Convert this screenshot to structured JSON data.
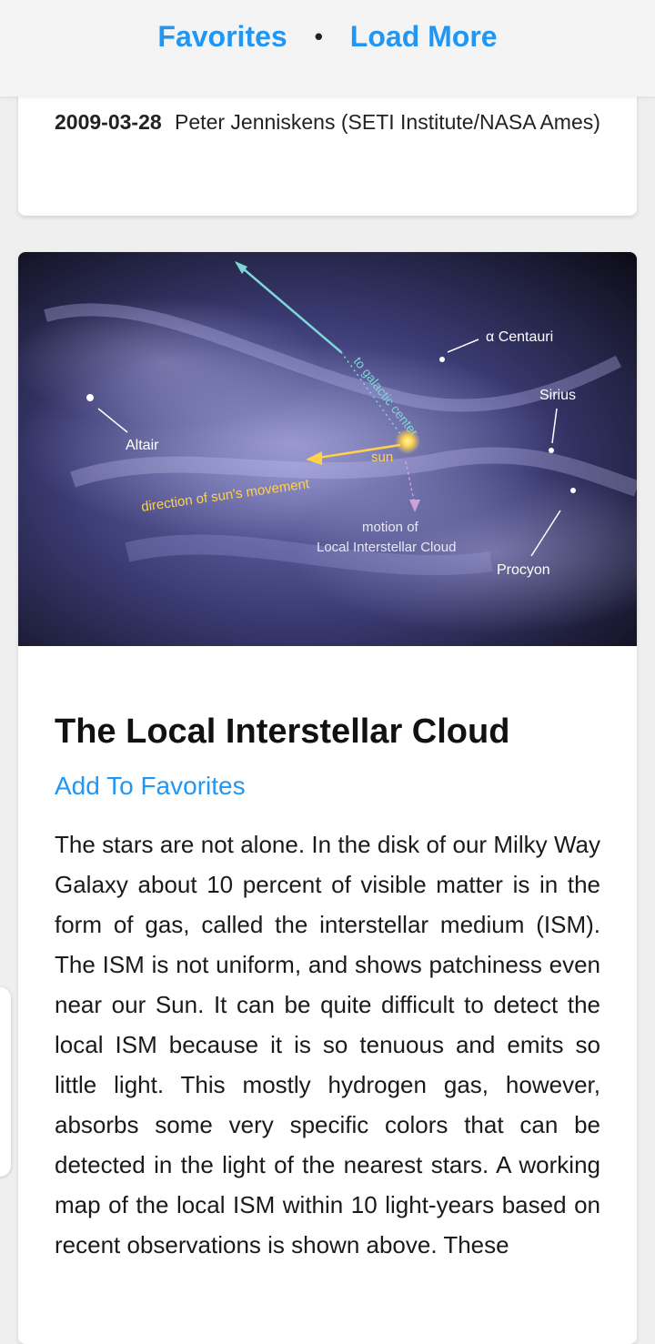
{
  "nav": {
    "favorites_label": "Favorites",
    "separator": "•",
    "load_more_label": "Load More",
    "accent_color": "#2196f3"
  },
  "previous_entry": {
    "date": "2009-03-28",
    "credit": "Peter Jenniskens (SETI Institute/NASA Ames)"
  },
  "entry": {
    "image_labels": {
      "alpha_centauri": "α Centauri",
      "sirius": "Sirius",
      "altair": "Altair",
      "sun": "sun",
      "galactic_center": "to galactic center",
      "sun_direction": "direction of sun's movement",
      "cloud_motion_line1": "motion of",
      "cloud_motion_line2": "Local Interstellar Cloud",
      "procyon": "Procyon"
    },
    "title": "The Local Interstellar Cloud",
    "add_favorites_label": "Add To Favorites",
    "explanation": "The stars are not alone. In the disk of our Milky Way Galaxy about 10 percent of visible matter is in the form of gas, called the interstellar medium (ISM). The ISM is not uniform, and shows patchiness even near our Sun. It can be quite difficult to detect the local ISM because it is so tenuous and emits so little light. This mostly hydrogen gas, however, absorbs some very specific colors that can be detected in the light of the nearest stars. A working map of the local ISM within 10 light-years based on recent observations is shown above. These"
  }
}
